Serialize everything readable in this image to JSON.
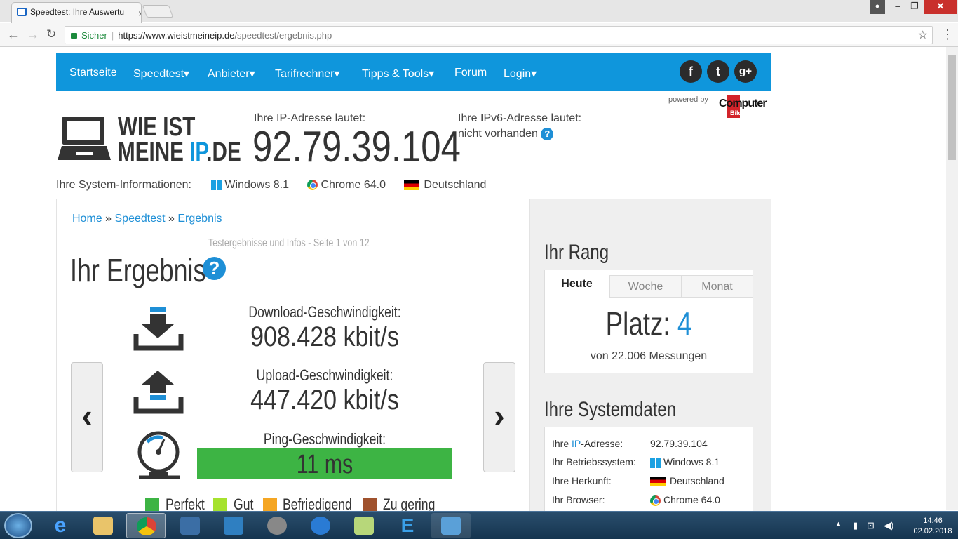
{
  "browser": {
    "tab_title": "Speedtest: Ihre Auswertu",
    "secure_label": "Sicher",
    "url_host": "https://www.wieistmeineip.de",
    "url_path": "/speedtest/ergebnis.php"
  },
  "nav": {
    "items": [
      "Startseite",
      "Speedtest▾",
      "Anbieter▾",
      "Tarifrechner▾",
      "Tipps & Tools▾",
      "Forum",
      "Login▾"
    ],
    "social": [
      "f",
      "t",
      "g+"
    ],
    "powered_by": "powered by",
    "partner": "Computer",
    "partner_sub": "Bild"
  },
  "logo": {
    "line1": "WIE IST",
    "line2_a": "MEINE ",
    "line2_ip": "IP",
    "line2_b": ".DE"
  },
  "ip": {
    "label": "Ihre IP-Adresse lautet:",
    "value": "92.79.39.104",
    "ipv6_label": "Ihre IPv6-Adresse lautet:",
    "ipv6_value": "nicht vorhanden",
    "help": "?"
  },
  "sysinfo": {
    "label": "Ihre System-Informationen:",
    "os": "Windows 8.1",
    "browser": "Chrome 64.0",
    "country": "Deutschland"
  },
  "result": {
    "breadcrumb": [
      "Home",
      "Speedtest",
      "Ergebnis"
    ],
    "breadcrumb_sep": "»",
    "page_info": "Testergebnisse und Infos - Seite 1 von 12",
    "title": "Ihr Ergebnis",
    "download_label": "Download-Geschwindigkeit:",
    "download_value": "908.428 kbit/s",
    "upload_label": "Upload-Geschwindigkeit:",
    "upload_value": "447.420 kbit/s",
    "ping_label": "Ping-Geschwindigkeit:",
    "ping_value": "11 ms",
    "prev": "‹",
    "next": "›",
    "legend": [
      {
        "label": "Perfekt",
        "color": "#3db444"
      },
      {
        "label": "Gut",
        "color": "#a6e22e"
      },
      {
        "label": "Befriedigend",
        "color": "#f5a623"
      },
      {
        "label": "Zu gering",
        "color": "#a0522d"
      }
    ]
  },
  "rank": {
    "title": "Ihr Rang",
    "tabs": [
      "Heute",
      "Woche",
      "Monat"
    ],
    "platz_label": "Platz:",
    "platz_value": "4",
    "subtitle": "von 22.006 Messungen"
  },
  "systemdata": {
    "title": "Ihre Systemdaten",
    "rows": [
      {
        "key_a": "Ihre ",
        "key_b": "IP",
        "key_c": "-Adresse:",
        "value": "92.79.39.104"
      },
      {
        "key": "Ihr Betriebssystem:",
        "value": "Windows 8.1"
      },
      {
        "key": "Ihre Herkunft:",
        "value": "Deutschland"
      },
      {
        "key": "Ihr Browser:",
        "value": "Chrome 64.0"
      }
    ]
  },
  "taskbar": {
    "time": "14:46",
    "date": "02.02.2018"
  }
}
